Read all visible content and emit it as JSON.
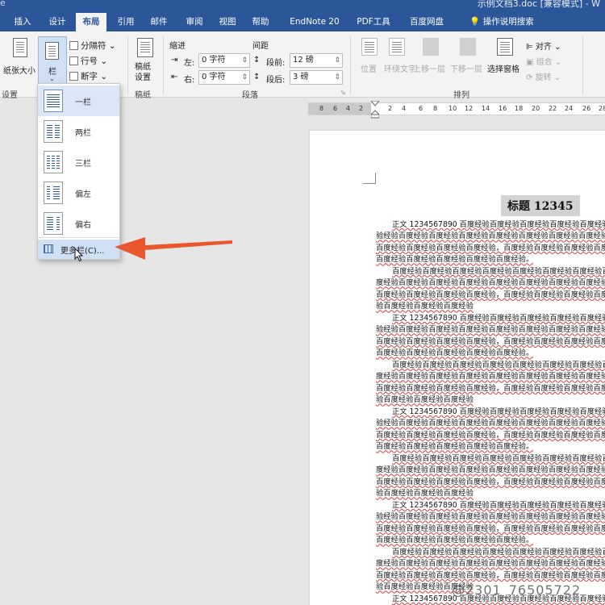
{
  "window": {
    "doc_title": "示例文档3.doc [兼容模式] - W",
    "lead_char": "e"
  },
  "tabs": [
    "插入",
    "设计",
    "布局",
    "引用",
    "邮件",
    "审阅",
    "视图",
    "帮助",
    "EndNote 20",
    "PDF工具",
    "百度网盘"
  ],
  "active_tab": "布局",
  "tell_me": "操作说明搜索",
  "ribbon": {
    "page_setup": {
      "paper_size": "纸张大小",
      "columns": "栏",
      "breaks": "分隔符",
      "line_numbers": "行号",
      "hyphenation": "断字",
      "group_label": "设置"
    },
    "manuscript": {
      "button": "稿纸\n设置",
      "group_label": "稿纸"
    },
    "paragraph": {
      "indent_header": "缩进",
      "spacing_header": "间距",
      "left_label": "左:",
      "left_value": "0 字符",
      "right_label": "右:",
      "right_value": "0 字符",
      "before_label": "段前:",
      "before_value": "12 磅",
      "after_label": "段后:",
      "after_value": "3 磅",
      "group_label": "段落"
    },
    "arrange": {
      "position": "位置",
      "wrap_text": "环绕文字",
      "bring_forward": "上移一层",
      "send_backward": "下移一层",
      "selection_pane": "选择窗格",
      "align": "对齐",
      "group": "组合",
      "rotate": "旋转",
      "group_label": "排列"
    }
  },
  "columns_menu": {
    "items": [
      {
        "label": "一栏",
        "cols": 1,
        "selected": true
      },
      {
        "label": "两栏",
        "cols": 2,
        "selected": false
      },
      {
        "label": "三栏",
        "cols": 3,
        "selected": false
      },
      {
        "label": "偏左",
        "cols": 2,
        "selected": false
      },
      {
        "label": "偏右",
        "cols": 2,
        "selected": false
      }
    ],
    "more": "更多栏(C)..."
  },
  "ruler": [
    "8",
    "6",
    "4",
    "2",
    "2",
    "4",
    "6",
    "8",
    "10",
    "12",
    "14",
    "16",
    "18",
    "20",
    "22",
    "24",
    "26",
    "28"
  ],
  "document": {
    "heading": "标题 12345",
    "paragraphs": [
      [
        "正文 1234567890 百度经验百度经验百度经验百度经验百度经验百度经验",
        "验经验百度经验百度经验百度经验百度经验百度经验百度经验百度经验百度经验",
        "百度经验百度经验百度经验百度经验，百度经验百度经验百度经验百度经验百度",
        "百度经验百度经验百度经验百度经验百度经验。"
      ],
      [
        "百度经验百度经验百度经验百度经验百度经验百度经验百度经验百度经验",
        "度经验百度经验百度经验百度经验百度经验百度经验百度经验百度经验百度经验",
        "百度经验百度经验百度经验百度经验，百度经验百度经验百度经验百度经验百度经验",
        "验百度经验百度经验百度经验"
      ],
      [
        "正文 1234567890 百度经验百度经验百度经验百度经验百度经验百度经验",
        "验经验百度经验百度经验百度经验百度经验百度经验百度经验百度经验百度经验",
        "百度经验百度经验百度经验百度经验，百度经验百度经验百度经验百度经验百度",
        "百度经验百度经验百度经验百度经验百度经验。"
      ],
      [
        "百度经验百度经验百度经验百度经验百度经验百度经验百度经验百度经验",
        "度经验百度经验百度经验百度经验百度经验百度经验百度经验百度经验百度经验",
        "百度经验百度经验百度经验百度经验，百度经验百度经验百度经验百度经验百度经验",
        "验百度经验百度经验百度经验"
      ],
      [
        "正文 1234567890 百度经验百度经验百度经验百度经验百度经验百度经验",
        "验经验百度经验百度经验百度经验百度经验百度经验百度经验百度经验百度经验",
        "百度经验百度经验百度经验百度经验，百度经验百度经验百度经验百度经验百度",
        "百度经验百度经验百度经验百度经验百度经验。"
      ],
      [
        "百度经验百度经验百度经验百度经验百度经验百度经验百度经验百度经验",
        "度经验百度经验百度经验百度经验百度经验百度经验百度经验百度经验百度经验",
        "百度经验百度经验百度经验百度经验，百度经验百度经验百度经验百度经验百度经验",
        "验百度经验百度经验百度经验"
      ],
      [
        "正文 1234567890 百度经验百度经验百度经验百度经验百度经验百度经验",
        "验经验百度经验百度经验百度经验百度经验百度经验百度经验百度经验百度经验",
        "百度经验百度经验百度经验百度经验，百度经验百度经验百度经验百度经验百度",
        "百度经验百度经验百度经验百度经验百度经验。"
      ],
      [
        "百度经验百度经验百度经验百度经验百度经验百度经验百度经验百度经验",
        "度经验百度经验百度经验百度经验百度经验百度经验百度经验百度经验百度经验",
        "百度经验百度经验百度经验百度经验，百度经验百度经验百度经验百度经验百度经验",
        "验百度经验百度经验百度经验"
      ],
      [
        "正文 1234567890 百度经验百度经验百度经验百度经验百度经验百度经验"
      ]
    ]
  },
  "watermark": "@2301_76505722",
  "colors": {
    "ribbon_blue": "#2b579a",
    "annotation_arrow": "#e8572d",
    "spell_underline": "#d23c3c"
  }
}
